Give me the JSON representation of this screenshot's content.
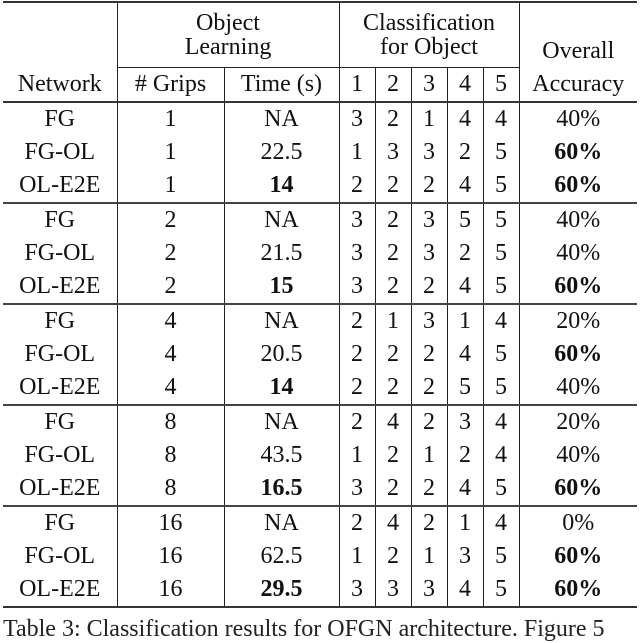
{
  "table": {
    "headers": {
      "network": "Network",
      "object_learning_line1": "Object",
      "object_learning_line2": "Learning",
      "grips": "# Grips",
      "time": "Time (s)",
      "classification_line1": "Classification",
      "classification_line2": "for Object",
      "class_columns": [
        "1",
        "2",
        "3",
        "4",
        "5"
      ],
      "overall_line1": "Overall",
      "overall_line2": "Accuracy"
    },
    "rows": [
      {
        "network": "FG",
        "grips": "1",
        "time": "NA",
        "time_bold": false,
        "cls": [
          "3",
          "2",
          "1",
          "4",
          "4"
        ],
        "accuracy": "40%",
        "accuracy_bold": false
      },
      {
        "network": "FG-OL",
        "grips": "1",
        "time": "22.5",
        "time_bold": false,
        "cls": [
          "1",
          "3",
          "3",
          "2",
          "5"
        ],
        "accuracy": "60%",
        "accuracy_bold": true
      },
      {
        "network": "OL-E2E",
        "grips": "1",
        "time": "14",
        "time_bold": true,
        "cls": [
          "2",
          "2",
          "2",
          "4",
          "5"
        ],
        "accuracy": "60%",
        "accuracy_bold": true
      },
      {
        "network": "FG",
        "grips": "2",
        "time": "NA",
        "time_bold": false,
        "cls": [
          "3",
          "2",
          "3",
          "5",
          "5"
        ],
        "accuracy": "40%",
        "accuracy_bold": false
      },
      {
        "network": "FG-OL",
        "grips": "2",
        "time": "21.5",
        "time_bold": false,
        "cls": [
          "3",
          "2",
          "3",
          "2",
          "5"
        ],
        "accuracy": "40%",
        "accuracy_bold": false
      },
      {
        "network": "OL-E2E",
        "grips": "2",
        "time": "15",
        "time_bold": true,
        "cls": [
          "3",
          "2",
          "2",
          "4",
          "5"
        ],
        "accuracy": "60%",
        "accuracy_bold": true
      },
      {
        "network": "FG",
        "grips": "4",
        "time": "NA",
        "time_bold": false,
        "cls": [
          "2",
          "1",
          "3",
          "1",
          "4"
        ],
        "accuracy": "20%",
        "accuracy_bold": false
      },
      {
        "network": "FG-OL",
        "grips": "4",
        "time": "20.5",
        "time_bold": false,
        "cls": [
          "2",
          "2",
          "2",
          "4",
          "5"
        ],
        "accuracy": "60%",
        "accuracy_bold": true
      },
      {
        "network": "OL-E2E",
        "grips": "4",
        "time": "14",
        "time_bold": true,
        "cls": [
          "2",
          "2",
          "2",
          "5",
          "5"
        ],
        "accuracy": "40%",
        "accuracy_bold": false
      },
      {
        "network": "FG",
        "grips": "8",
        "time": "NA",
        "time_bold": false,
        "cls": [
          "2",
          "4",
          "2",
          "3",
          "4"
        ],
        "accuracy": "20%",
        "accuracy_bold": false
      },
      {
        "network": "FG-OL",
        "grips": "8",
        "time": "43.5",
        "time_bold": false,
        "cls": [
          "1",
          "2",
          "1",
          "2",
          "4"
        ],
        "accuracy": "40%",
        "accuracy_bold": false
      },
      {
        "network": "OL-E2E",
        "grips": "8",
        "time": "16.5",
        "time_bold": true,
        "cls": [
          "3",
          "2",
          "2",
          "4",
          "5"
        ],
        "accuracy": "60%",
        "accuracy_bold": true
      },
      {
        "network": "FG",
        "grips": "16",
        "time": "NA",
        "time_bold": false,
        "cls": [
          "2",
          "4",
          "2",
          "1",
          "4"
        ],
        "accuracy": "0%",
        "accuracy_bold": false
      },
      {
        "network": "FG-OL",
        "grips": "16",
        "time": "62.5",
        "time_bold": false,
        "cls": [
          "1",
          "2",
          "1",
          "3",
          "5"
        ],
        "accuracy": "60%",
        "accuracy_bold": true
      },
      {
        "network": "OL-E2E",
        "grips": "16",
        "time": "29.5",
        "time_bold": true,
        "cls": [
          "3",
          "3",
          "3",
          "4",
          "5"
        ],
        "accuracy": "60%",
        "accuracy_bold": true
      }
    ],
    "group_size": 3
  },
  "caption": "Table 3: Classification results for OFGN architecture. Figure 5"
}
